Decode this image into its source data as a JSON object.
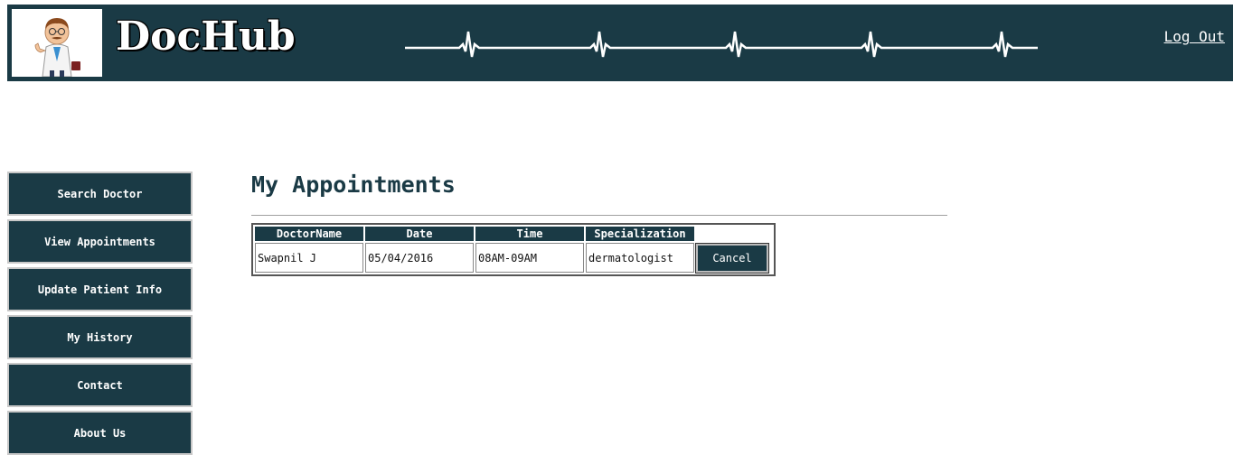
{
  "header": {
    "brand": "DocHub",
    "logout_label": "Log Out"
  },
  "sidebar": {
    "items": [
      {
        "label": "Search Doctor"
      },
      {
        "label": "View Appointments"
      },
      {
        "label": "Update Patient Info"
      },
      {
        "label": "My History"
      },
      {
        "label": "Contact"
      },
      {
        "label": "About Us"
      }
    ]
  },
  "main": {
    "title": "My Appointments",
    "table": {
      "headers": [
        "DoctorName",
        "Date",
        "Time",
        "Specialization"
      ],
      "rows": [
        {
          "doctor": "Swapnil J",
          "date": "05/04/2016",
          "time": "08AM-09AM",
          "specialization": "dermatologist",
          "action_label": "Cancel"
        }
      ]
    }
  },
  "colors": {
    "primary": "#1a3a45",
    "accent_white": "#ffffff"
  }
}
